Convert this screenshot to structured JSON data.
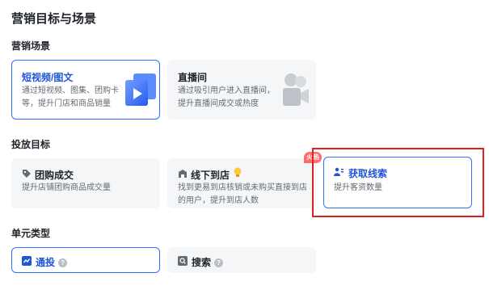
{
  "page_title": "营销目标与场景",
  "sections": {
    "scene": {
      "title": "营销场景",
      "cards": [
        {
          "title": "短视频/图文",
          "desc": "通过短视频、图集、团购卡等，提升门店和商品销量",
          "selected": true
        },
        {
          "title": "直播间",
          "desc": "通过吸引用户进入直播间，提升直播间成交或热度",
          "selected": false
        }
      ]
    },
    "goal": {
      "title": "投放目标",
      "cards": [
        {
          "title": "团购成交",
          "desc": "提升店铺团购商品成交量",
          "icon": "tag-icon",
          "selected": false
        },
        {
          "title": "线下到店",
          "desc": "找到更易到店核销或未购买直接到店的用户，提升到店人数",
          "icon": "store-icon",
          "extra_icon": "bulb-icon",
          "badge": "火热",
          "selected": false
        },
        {
          "title": "获取线索",
          "desc": "提升客资数量",
          "icon": "leads-icon",
          "selected": true
        }
      ]
    },
    "unit": {
      "title": "单元类型",
      "cards": [
        {
          "title": "通投",
          "icon": "broad-icon",
          "selected": true
        },
        {
          "title": "搜索",
          "icon": "search-icon",
          "selected": false
        }
      ]
    }
  },
  "colors": {
    "accent": "#3370ff",
    "highlight": "#e02020"
  }
}
